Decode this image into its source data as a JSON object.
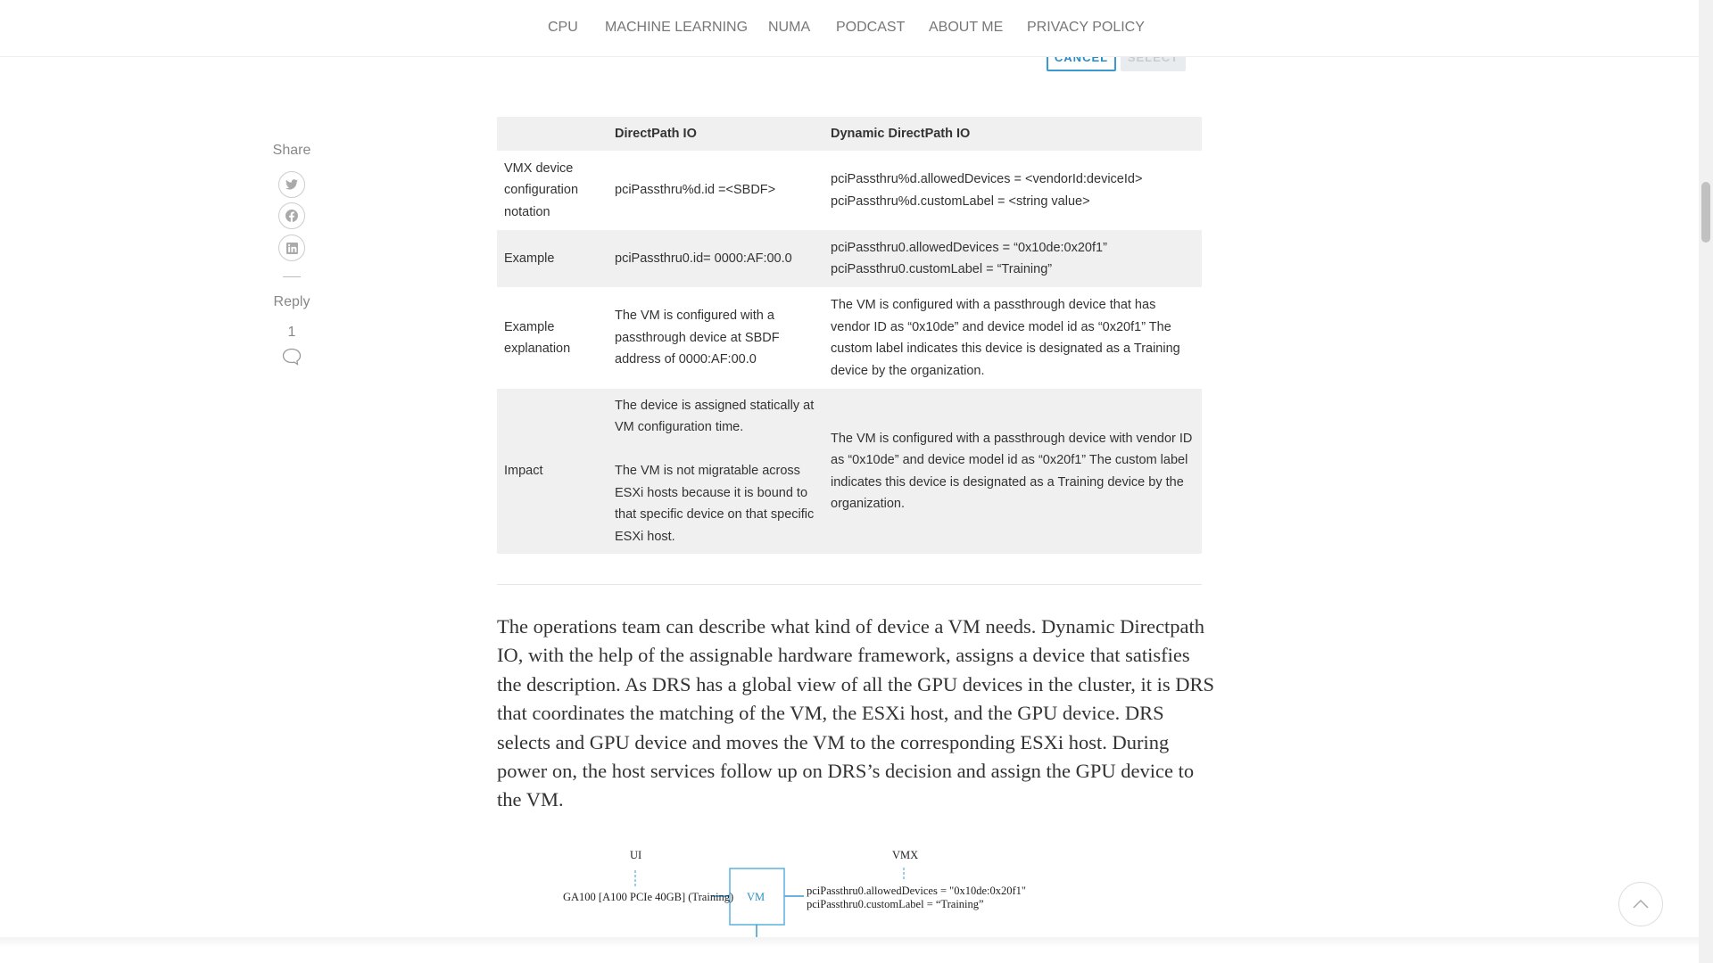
{
  "nav": [
    "CPU",
    "MACHINE LEARNING",
    "NUMA",
    "PODCAST",
    "ABOUT ME",
    "PRIVACY POLICY"
  ],
  "buttons": {
    "cancel": "CANCEL",
    "select": "SELECT"
  },
  "table": {
    "headers": [
      "",
      "DirectPath IO",
      "Dynamic DirectPath IO"
    ],
    "rows": [
      [
        "VMX device configuration notation",
        "pciPassthru%d.id =<SBDF>",
        "pciPassthru%d.allowedDevices = <vendorId:deviceId>\npciPassthru%d.customLabel = <string value>"
      ],
      [
        "Example",
        "pciPassthru0.id= 0000:AF:00.0",
        "pciPassthru0.allowedDevices = “0x10de:0x20f1”\npciPassthru0.customLabel = “Training”"
      ],
      [
        "Example explanation",
        "The VM is configured with a passthrough device at SBDF address of 0000:AF:00.0",
        "The VM is configured with a passthrough device that has vendor ID as “0x10de” and device model id as “0x20f1” The custom label indicates this device is designated as a Training device by the organization."
      ],
      [
        "Impact",
        "The device is assigned statically at VM configuration time.\n\nThe VM is not migratable across ESXi hosts because it is bound to that specific device on that specific ESXi host.",
        "The VM is configured with a passthrough device with vendor ID as “0x10de” and device model id as “0x20f1” The custom label indicates this device is designated as a Training device by the organization."
      ]
    ]
  },
  "paragraph": [
    "The operations team can describe what kind of device a VM needs. Dynamic Directpath",
    "IO, with the help of the assignable hardware framework, assigns a device that satisfies",
    "the description. As DRS has a global view of all the GPU devices in the cluster, it is DRS",
    "that coordinates the matching of the VM, the ESXi host, and the GPU device. DRS",
    "selects and GPU device and moves the VM to the corresponding ESXi host. During",
    "power on, the host services follow up on DRS’s decision and assign the GPU device to",
    "the VM."
  ],
  "diagram": {
    "ui": "UI",
    "vmx": "VMX",
    "vm": "VM",
    "device": "GA100 [A100 PCIe 40GB] (Training)",
    "vmx_line1": "pciPassthru0.allowedDevices = \"0x10de:0x20f1\"",
    "vmx_line2": "pciPassthru0.customLabel = “Training”",
    "accent": "#3a9ad0"
  },
  "sidebar": {
    "share": "Share",
    "reply": "Reply",
    "comment_count": "1",
    "icons": [
      "twitter-icon",
      "facebook-icon",
      "linkedin-icon"
    ]
  }
}
